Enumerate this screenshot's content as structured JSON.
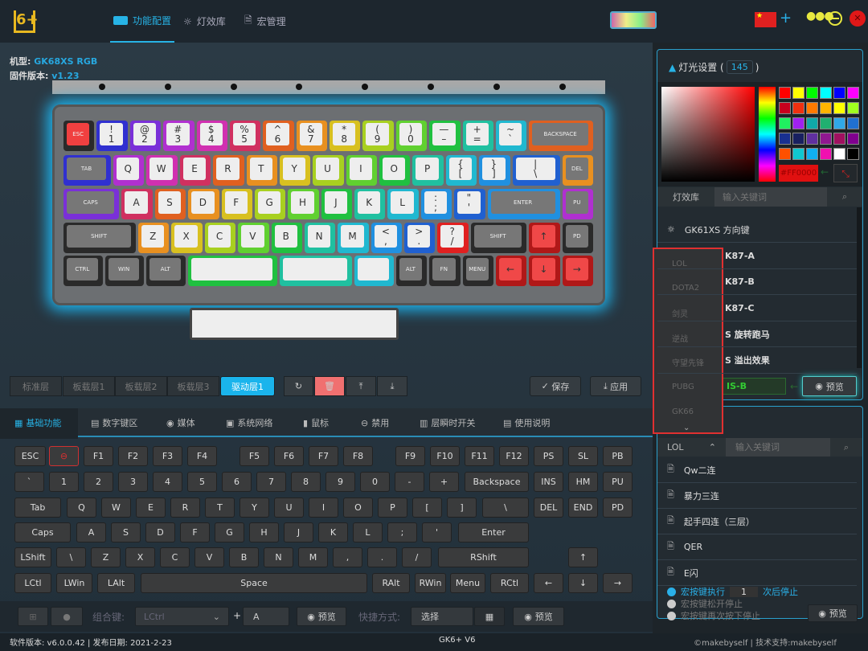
{
  "nav": {
    "logo": "6+",
    "tabs": [
      {
        "label": "功能配置",
        "icon": "keyboard-icon",
        "active": true
      },
      {
        "label": "灯效库",
        "icon": "bulb-icon"
      },
      {
        "label": "宏管理",
        "icon": "document-icon"
      }
    ],
    "language_flag": "china-flag-icon"
  },
  "device": {
    "model_label": "机型:",
    "model": "GK68XS RGB",
    "fw_label": "固件版本:",
    "fw": "v1.23"
  },
  "keyboard": {
    "rows": [
      [
        "ESC",
        "!\n1",
        "@\n2",
        "#\n3",
        "$\n4",
        "%\n5",
        "^\n6",
        "&\n7",
        "*\n8",
        "(\n9",
        ")\n0",
        "—\n–",
        "+\n=",
        "~\n`",
        "BACKSPACE"
      ],
      [
        "TAB",
        "Q",
        "W",
        "E",
        "R",
        "T",
        "Y",
        "U",
        "I",
        "O",
        "P",
        "{\n[",
        "}\n]",
        "|\n\\",
        "DEL"
      ],
      [
        "CAPS",
        "A",
        "S",
        "D",
        "F",
        "G",
        "H",
        "J",
        "K",
        "L",
        ":\n;",
        "\"\n'",
        "ENTER",
        "PU"
      ],
      [
        "SHIFT",
        "Z",
        "X",
        "C",
        "V",
        "B",
        "N",
        "M",
        "<\n,",
        ">\n.",
        "?\n/",
        "SHIFT",
        "↑",
        "PD"
      ],
      [
        "CTRL",
        "WIN",
        "ALT",
        "",
        "",
        "",
        "ALT",
        "FN",
        "MENU",
        "←",
        "↓",
        "→"
      ]
    ],
    "palette": [
      "#e02020",
      "#3030d0",
      "#7a30d8",
      "#b030d0",
      "#d030b0",
      "#d03060",
      "#e06020",
      "#e89020",
      "#d8c020",
      "#a8d020",
      "#60d030",
      "#20c040",
      "#20c0a0",
      "#20b8d0",
      "#2090e0",
      "#2060d0"
    ],
    "glow": "#1fb6f0"
  },
  "layers": {
    "items": [
      "标准层",
      "板载层1",
      "板载层2",
      "板载层3",
      "驱动层1"
    ],
    "active": 4,
    "save": "保存",
    "apply": "应用"
  },
  "functabs": [
    {
      "label": "基础功能",
      "icon": "keyboard-icon",
      "active": true
    },
    {
      "label": "数字键区",
      "icon": "calculator-icon"
    },
    {
      "label": "媒体",
      "icon": "media-icon"
    },
    {
      "label": "系统网络",
      "icon": "monitor-icon"
    },
    {
      "label": "鼠标",
      "icon": "mouse-icon"
    },
    {
      "label": "禁用",
      "icon": "disable-icon"
    },
    {
      "label": "层瞬时开关",
      "icon": "layers-icon"
    },
    {
      "label": "使用说明",
      "icon": "manual-icon"
    }
  ],
  "keys": [
    [
      "ESC",
      "⊖",
      "F1",
      "F2",
      "F3",
      "F4",
      "F5",
      "F6",
      "F7",
      "F8",
      "F9",
      "F10",
      "F11",
      "F12",
      "PS",
      "SL",
      "PB"
    ],
    [
      "`",
      "1",
      "2",
      "3",
      "4",
      "5",
      "6",
      "7",
      "8",
      "9",
      "0",
      "-",
      "+",
      "Backspace",
      "INS",
      "HM",
      "PU"
    ],
    [
      "Tab",
      "Q",
      "W",
      "E",
      "R",
      "T",
      "Y",
      "U",
      "I",
      "O",
      "P",
      "[",
      "]",
      "\\",
      "DEL",
      "END",
      "PD"
    ],
    [
      "Caps",
      "A",
      "S",
      "D",
      "F",
      "G",
      "H",
      "J",
      "K",
      "L",
      ";",
      "'",
      "Enter"
    ],
    [
      "LShift",
      "\\",
      "Z",
      "X",
      "C",
      "V",
      "B",
      "N",
      "M",
      ",",
      ".",
      "/",
      "RShift",
      "↑"
    ],
    [
      "LCtl",
      "LWin",
      "LAlt",
      "Space",
      "RAlt",
      "RWin",
      "Menu",
      "RCtl",
      "←",
      "↓",
      "→"
    ]
  ],
  "combo": {
    "label": "组合键:",
    "modifier": "LCtrl",
    "plus": "+",
    "key": "A",
    "preview": "预览",
    "shortcut_label": "快捷方式:",
    "shortcut_value": "选择",
    "preview2": "预览"
  },
  "status": {
    "left": "软件版本: v6.0.0.42 | 发布日期: 2021-2-23",
    "center": "GK6+ V6",
    "right": "©makebyself | 技术支持:makebyself"
  },
  "light": {
    "title": "灯光设置 (",
    "count": "145",
    "close": ")",
    "hex": "#FF0000",
    "swatches": [
      "#ff0000",
      "#ffff00",
      "#00ff00",
      "#00ffff",
      "#0000ff",
      "#ff00ff",
      "#c8001e",
      "#f03010",
      "#ff7a00",
      "#ffb400",
      "#ffff00",
      "#a0ff20",
      "#20f060",
      "#a020f0",
      "#10a8a8",
      "#20b070",
      "#30a8e8",
      "#2070d0",
      "#183090",
      "#182060",
      "#6030a0",
      "#901890",
      "#a01060",
      "#800090",
      "#ff5000",
      "#10c8d0",
      "#10b0f0",
      "#f010b0",
      "#ffffff",
      "#000000"
    ],
    "lib_label": "灯效库",
    "search_placeholder": "输入关键词",
    "effects": [
      "GK61XS 方向键",
      "K87-A",
      "K87-B",
      "K87-C",
      "S 旋转跑马",
      "S 溢出效果"
    ],
    "current": "IS-B",
    "preview": "预览"
  },
  "dropdown": {
    "options": [
      "LOL",
      "DOTA2",
      "剑灵",
      "逆战",
      "守望先锋",
      "PUBG",
      "GK66"
    ]
  },
  "macro": {
    "category": "LOL",
    "search_placeholder": "输入关键词",
    "items": [
      "Qw二连",
      "暴力三连",
      "起手四连（三层）",
      "QER",
      "E闪"
    ],
    "opt1_pre": "宏按键执行",
    "opt1_count": "1",
    "opt1_post": "次后停止",
    "opt2": "宏按键松开停止",
    "opt3": "宏按键再次按下停止",
    "preview": "预览"
  }
}
